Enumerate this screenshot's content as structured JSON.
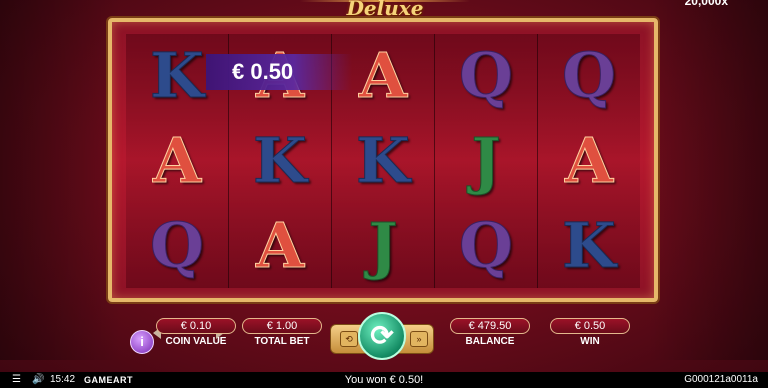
{
  "header": {
    "logo_text": "Deluxe",
    "jackpot_text": "20,000x"
  },
  "reels": [
    [
      "K",
      "A",
      "Q"
    ],
    [
      "A",
      "K",
      "A"
    ],
    [
      "A",
      "K",
      "J"
    ],
    [
      "Q",
      "J",
      "Q"
    ],
    [
      "Q",
      "A",
      "K"
    ]
  ],
  "win_badge": "€ 0.50",
  "controls": {
    "info_label": "i",
    "coin_value": {
      "value": "€ 0.10",
      "label": "COIN VALUE"
    },
    "total_bet": {
      "value": "€ 1.00",
      "label": "TOTAL BET"
    },
    "spin_label": "⟳",
    "balance": {
      "value": "€ 479.50",
      "label": "BALANCE"
    },
    "win": {
      "value": "€ 0.50",
      "label": "WIN"
    }
  },
  "statusbar": {
    "menu_icon": "☰",
    "sound_icon": "🔊",
    "time": "15:42",
    "provider": "GAMEART",
    "message": "You won € 0.50!",
    "game_id": "G000121a0011a"
  }
}
